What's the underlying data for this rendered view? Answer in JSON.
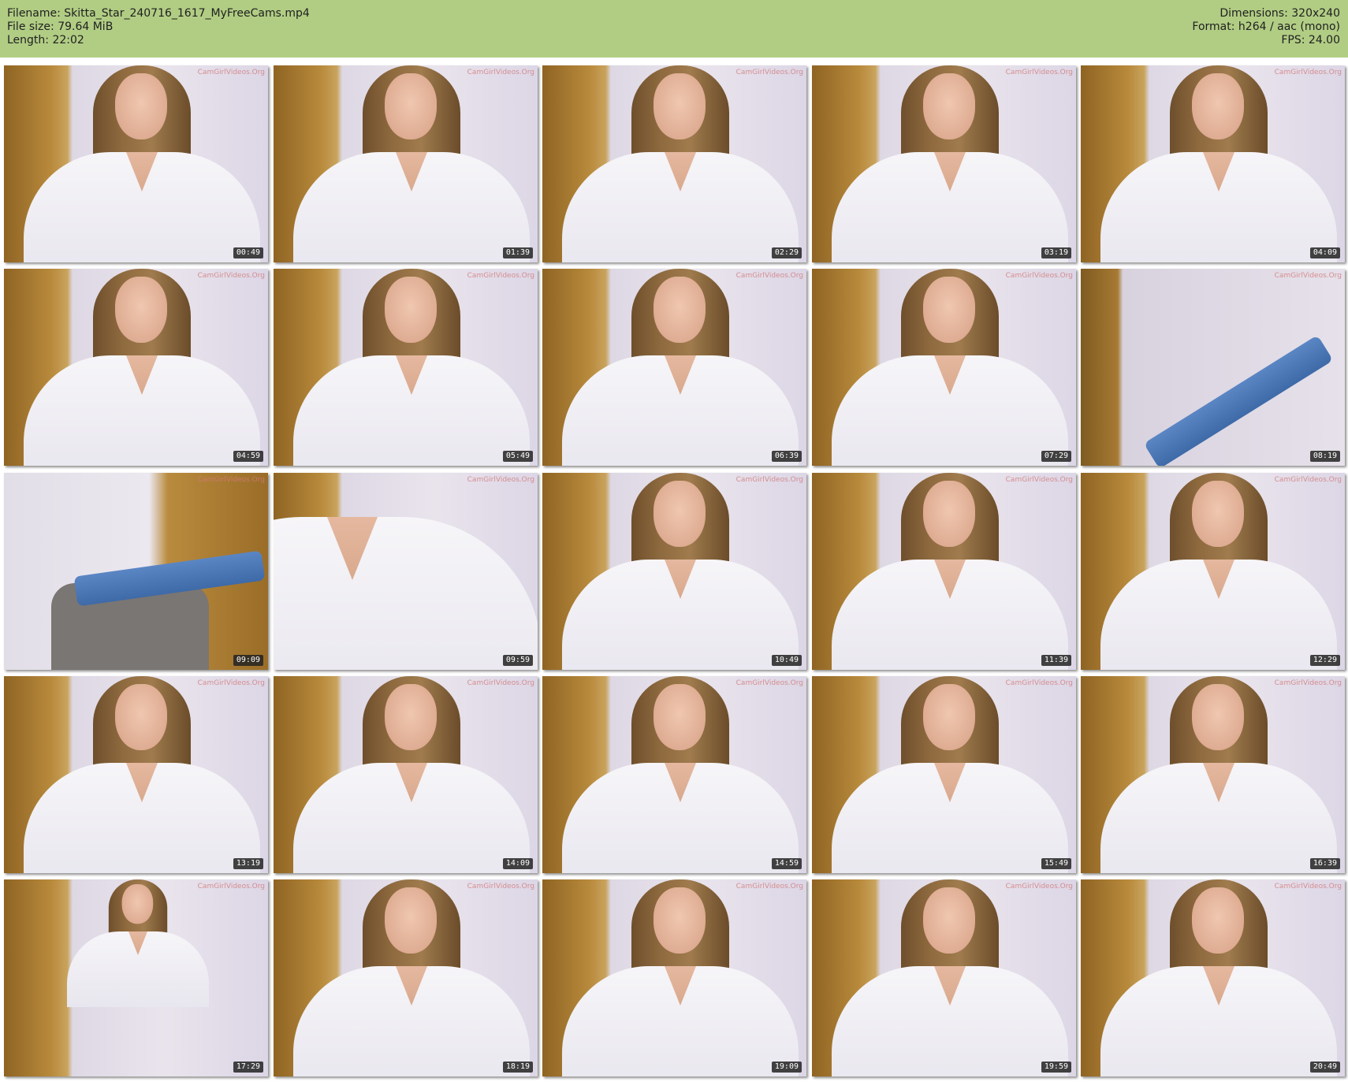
{
  "header": {
    "filename_line": "Filename: Skitta_Star_240716_1617_MyFreeCams.mp4",
    "filesize_line": "File size: 79.64 MiB",
    "length_line": "Length: 22:02",
    "dimensions_line": "Dimensions: 320x240",
    "format_line": "Format: h264 / aac (mono)",
    "fps_line": "FPS: 24.00",
    "background_color": "#b1cd84"
  },
  "watermark": "CamGirlVideos.Org",
  "thumbnails": [
    {
      "timestamp": "00:49"
    },
    {
      "timestamp": "01:39"
    },
    {
      "timestamp": "02:29"
    },
    {
      "timestamp": "03:19"
    },
    {
      "timestamp": "04:09"
    },
    {
      "timestamp": "04:59"
    },
    {
      "timestamp": "05:49"
    },
    {
      "timestamp": "06:39"
    },
    {
      "timestamp": "07:29"
    },
    {
      "timestamp": "08:19"
    },
    {
      "timestamp": "09:09"
    },
    {
      "timestamp": "09:59"
    },
    {
      "timestamp": "10:49"
    },
    {
      "timestamp": "11:39"
    },
    {
      "timestamp": "12:29"
    },
    {
      "timestamp": "13:19"
    },
    {
      "timestamp": "14:09"
    },
    {
      "timestamp": "14:59"
    },
    {
      "timestamp": "15:49"
    },
    {
      "timestamp": "16:39"
    },
    {
      "timestamp": "17:29"
    },
    {
      "timestamp": "18:19"
    },
    {
      "timestamp": "19:09"
    },
    {
      "timestamp": "19:59"
    },
    {
      "timestamp": "20:49"
    }
  ]
}
